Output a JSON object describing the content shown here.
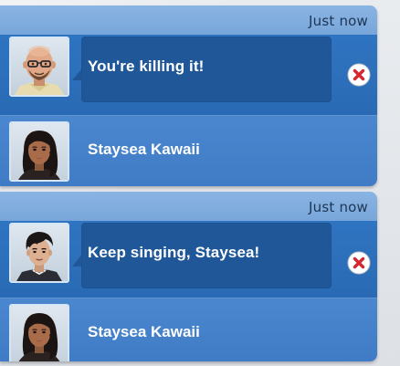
{
  "notifications": [
    {
      "timestamp": "Just now",
      "message": "You're killing it!",
      "sender_portrait": "bald-man-with-glasses-portrait",
      "recipient_name": "Staysea Kawaii",
      "recipient_portrait": "staysea-kawaii-portrait",
      "close_icon": "close-x-icon"
    },
    {
      "timestamp": "Just now",
      "message": "Keep singing, Staysea!",
      "sender_portrait": "dark-haired-man-portrait",
      "recipient_name": "Staysea Kawaii",
      "recipient_portrait": "staysea-kawaii-portrait",
      "close_icon": "close-x-icon"
    }
  ],
  "colors": {
    "header": "#8ab4e3",
    "message_row": "#2f74c1",
    "bubble": "#1f5799",
    "sender_row": "#4a87cf",
    "close_red": "#d6262f"
  }
}
